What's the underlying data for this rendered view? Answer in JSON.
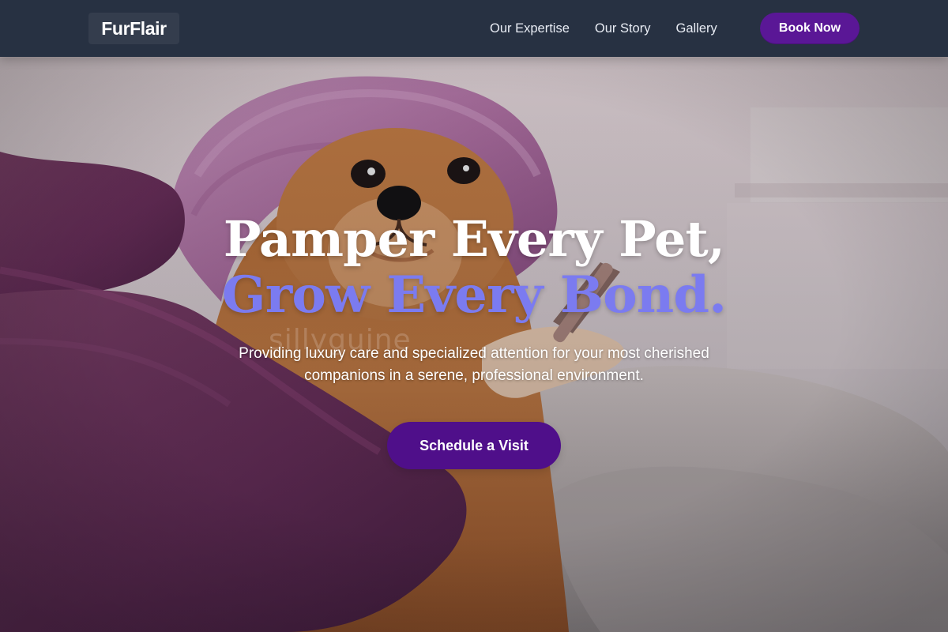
{
  "brand": {
    "name": "FurFlair"
  },
  "nav": {
    "items": [
      {
        "label": "Our Expertise"
      },
      {
        "label": "Our Story"
      },
      {
        "label": "Gallery"
      }
    ],
    "cta": "Book Now"
  },
  "hero": {
    "headline_line1": "Pamper Every Pet,",
    "headline_line2": "Grow Every Bond.",
    "subtitle": "Providing luxury care and specialized attention for your most cherished companions in a serene, professional environment.",
    "cta": "Schedule a Visit",
    "watermark": "sillyguine"
  },
  "colors": {
    "nav_background": "#273142",
    "brand_box": "#343d4d",
    "primary_button": "#5a1796",
    "hero_accent": "#7b7bf0",
    "hero_text": "#ffffff"
  },
  "icons": {
    "hero_image": "dog-grooming-photo"
  }
}
